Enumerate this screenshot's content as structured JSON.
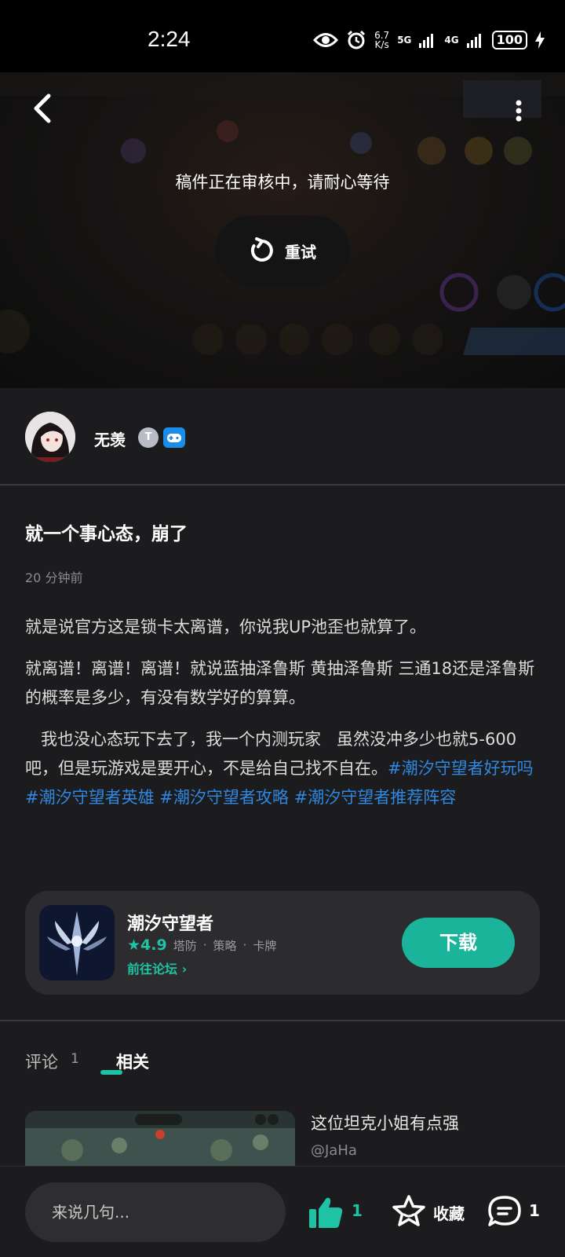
{
  "status_bar": {
    "time": "2:24",
    "speed_value": "6.7",
    "speed_unit": "K/s",
    "net1": "5G",
    "net2": "4G",
    "battery": "100"
  },
  "video": {
    "review_message": "稿件正在审核中，请耐心等待",
    "retry_label": "重试"
  },
  "author": {
    "name": "无羡",
    "level_badge": "T"
  },
  "post": {
    "title": "就一个事心态，崩了",
    "time": "20 分钟前",
    "paragraph1": "就是说官方这是锁卡太离谱，你说我UP池歪也就算了。",
    "paragraph2": "就离谱！离谱！离谱！就说蓝抽泽鲁斯  黄抽泽鲁斯  三通18还是泽鲁斯的概率是多少，有没有数学好的算算。",
    "paragraph3": "   我也没心态玩下去了，我一个内测玩家   虽然没冲多少也就5-600吧，但是玩游戏是要开心，不是给自己找不自在。",
    "tags": [
      "#潮汐守望者好玩吗",
      "#潮汐守望者英雄",
      "#潮汐守望者攻略",
      "#潮汐守望者推荐阵容"
    ]
  },
  "app_card": {
    "name": "潮汐守望者",
    "rating": "4.9",
    "genres": [
      "塔防",
      "策略",
      "卡牌"
    ],
    "forum_link": "前往论坛",
    "download_label": "下载"
  },
  "tabs": {
    "comments_label": "评论",
    "comments_count": "1",
    "related_label": "相关"
  },
  "related": {
    "title": "这位坦克小姐有点强",
    "author": "@JaHa"
  },
  "bottom_bar": {
    "input_placeholder": "来说几句...",
    "like_count": "1",
    "favorite_label": "收藏",
    "comment_count": "1"
  },
  "colors": {
    "accent": "#1ec3a6",
    "tag": "#2f87e0",
    "background": "#1c1c1e"
  }
}
